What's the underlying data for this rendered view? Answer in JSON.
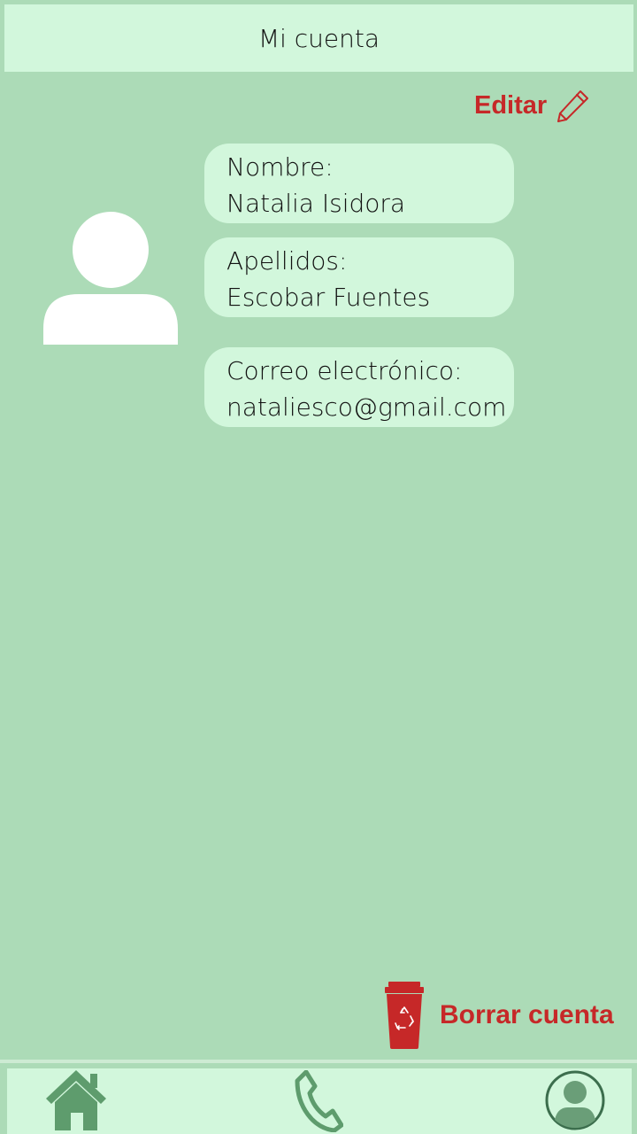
{
  "header": {
    "title": "Mi cuenta"
  },
  "actions": {
    "edit_label": "Editar",
    "delete_label": "Borrar cuenta"
  },
  "profile": {
    "name_label": "Nombre:",
    "name_value": "Natalia Isidora",
    "surname_label": "Apellidos:",
    "surname_value": "Escobar Fuentes",
    "email_label": "Correo electrónico:",
    "email_value": "nataliesco@gmail.com"
  },
  "nav": {
    "items": [
      {
        "icon": "home-icon"
      },
      {
        "icon": "phone-icon"
      },
      {
        "icon": "user-circle-icon"
      }
    ]
  },
  "colors": {
    "background": "#acdbb7",
    "panel": "#d2f7dc",
    "accent_red": "#c62828",
    "nav_icon": "#5e9c6d"
  }
}
